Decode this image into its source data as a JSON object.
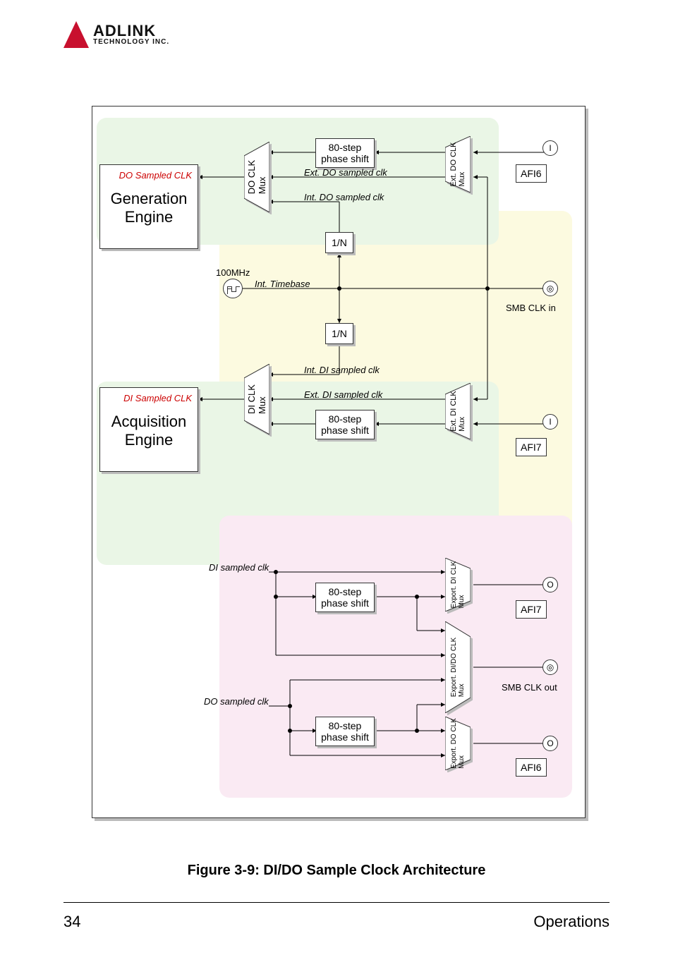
{
  "logo": {
    "title": "ADLINK",
    "subtitle": "TECHNOLOGY INC."
  },
  "footer": {
    "page": "34",
    "section": "Operations"
  },
  "caption": "Figure 3-9: DI/DO Sample Clock Architecture",
  "diagram": {
    "engines": {
      "generation": {
        "title": "Generation\nEngine",
        "clk_label": "DO Sampled CLK"
      },
      "acquisition": {
        "title": "Acquisition\nEngine",
        "clk_label": "DI Sampled CLK"
      }
    },
    "muxes": {
      "do_clk": "DO CLK\nMux",
      "ext_do_clk": "Ext. DO CLK\nMux",
      "di_clk": "DI CLK\nMux",
      "ext_di_clk": "Ext. DI CLK\nMux",
      "export_di_clk": "Export. DI CLK\nMux",
      "export_dido_clk": "Export. DI/DO CLK\nMux",
      "export_do_clk": "Export. DO CLK\nMux"
    },
    "blocks": {
      "phase_shift": "80-step\nphase shift",
      "div_n": "1/N"
    },
    "signals": {
      "ext_do_sampled": "Ext. DO sampled clk",
      "int_do_sampled": "Int. DO sampled clk",
      "int_timebase": "Int. Timebase",
      "int_di_sampled": "Int. DI sampled clk",
      "ext_di_sampled": "Ext. DI sampled clk",
      "di_sampled": "DI sampled clk",
      "do_sampled": "DO sampled clk",
      "freq_100": "100MHz"
    },
    "ports": {
      "afi6_in": {
        "tag": "I",
        "name": "AFI6"
      },
      "smb_in": {
        "name": "SMB CLK in"
      },
      "afi7_in": {
        "tag": "I",
        "name": "AFI7"
      },
      "afi7_out": {
        "tag": "O",
        "name": "AFI7"
      },
      "smb_out": {
        "name": "SMB CLK out"
      },
      "afi6_out": {
        "tag": "O",
        "name": "AFI6"
      }
    }
  }
}
